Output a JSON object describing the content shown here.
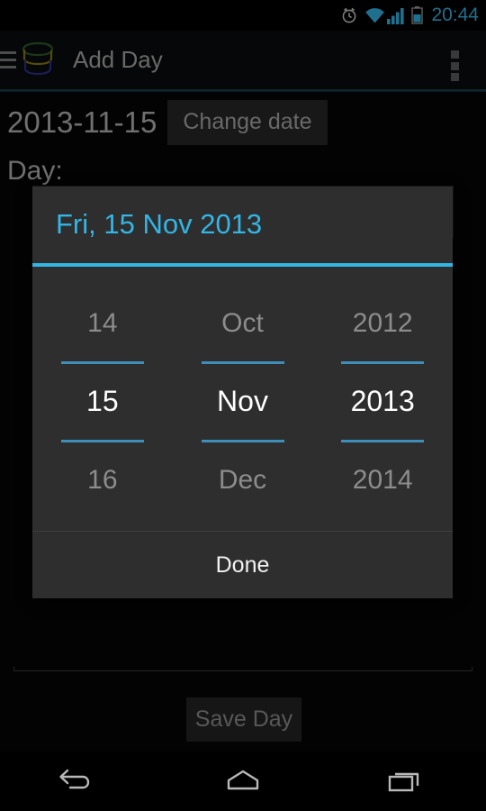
{
  "status_bar": {
    "clock": "20:44",
    "icons": [
      "alarm-icon",
      "wifi-icon",
      "signal-icon",
      "battery-icon"
    ]
  },
  "action_bar": {
    "drawer_icon": "hamburger-menu-icon",
    "logo_icon": "database-stack-logo",
    "title": "Add Day",
    "overflow_icon": "overflow-menu-icon"
  },
  "form": {
    "date_value": "2013-11-15",
    "change_date_label": "Change date",
    "day_label": "Day:",
    "day_input_value": "",
    "save_label": "Save Day"
  },
  "dialog": {
    "header": "Fri, 15 Nov 2013",
    "accent_color": "#33b5e5",
    "rule_color": "#3d8fb9",
    "background_color": "#2e2e2e",
    "done_label": "Done",
    "pickers": [
      {
        "name": "day",
        "previous": "14",
        "selected": "15",
        "next": "16"
      },
      {
        "name": "month",
        "previous": "Oct",
        "selected": "Nov",
        "next": "Dec"
      },
      {
        "name": "year",
        "previous": "2012",
        "selected": "2013",
        "next": "2014"
      }
    ]
  },
  "nav_bar": {
    "back": "back-icon",
    "home": "home-icon",
    "recents": "recents-icon"
  }
}
